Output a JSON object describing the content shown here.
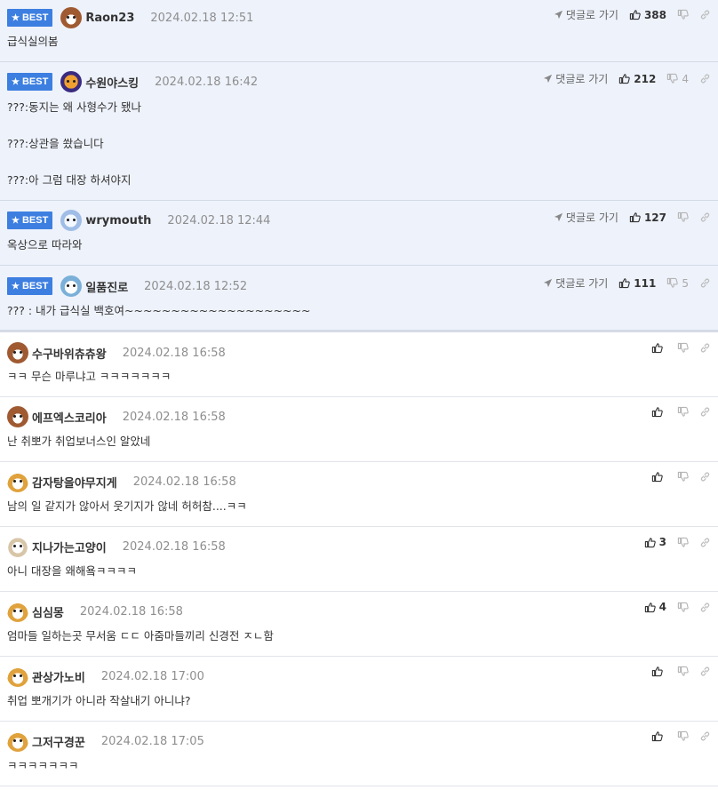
{
  "best_label": "BEST",
  "reply_label": "댓글로 가기",
  "best_comments": [
    {
      "nick": "Raon23",
      "date": "2024.02.18 12:51",
      "avatar_icon": "dog-avatar-icon",
      "up": "388",
      "down": "",
      "lines": [
        "급식실의봄"
      ]
    },
    {
      "nick": "수원야스킹",
      "date": "2024.02.18 16:42",
      "avatar_icon": "cat-avatar-icon",
      "up": "212",
      "down": "4",
      "lines": [
        "???:동지는 왜 사형수가 됐나",
        "???:상관을 쐈습니다",
        "???:아 그럼 대장 하셔야지"
      ]
    },
    {
      "nick": "wrymouth",
      "date": "2024.02.18 12:44",
      "avatar_icon": "ghost-avatar-icon",
      "up": "127",
      "down": "",
      "lines": [
        "옥상으로 따라와"
      ]
    },
    {
      "nick": "일품진로",
      "date": "2024.02.18 12:52",
      "avatar_icon": "seal-avatar-icon",
      "up": "111",
      "down": "5",
      "lines": [
        "??? : 내가 급식실 백호여~~~~~~~~~~~~~~~~~~~~"
      ]
    }
  ],
  "comments": [
    {
      "nick": "수구바위츄츄왕",
      "date": "2024.02.18 16:58",
      "avatar_icon": "dog-avatar-icon",
      "up": "",
      "text": "ㅋㅋ 무슨 마루냐고 ㅋㅋㅋㅋㅋㅋㅋ"
    },
    {
      "nick": "에프엑스코리아",
      "date": "2024.02.18 16:58",
      "avatar_icon": "dog-avatar-icon",
      "up": "",
      "text": "난 취뽀가 취업보너스인 알았네"
    },
    {
      "nick": "감자탕을야무지게",
      "date": "2024.02.18 16:58",
      "avatar_icon": "fox-avatar-icon",
      "up": "",
      "text": "남의 일 같지가 않아서 웃기지가 않네 허허참....ㅋㅋ"
    },
    {
      "nick": "지나가는고양이",
      "date": "2024.02.18 16:58",
      "avatar_icon": "puppy-avatar-icon",
      "up": "3",
      "text": "아니 대장을 왜해욬ㅋㅋㅋㅋ"
    },
    {
      "nick": "심심몽",
      "date": "2024.02.18 16:58",
      "avatar_icon": "fox-avatar-icon",
      "up": "4",
      "text": "엄마들 일하는곳 무서움 ㄷㄷ 아줌마들끼리 신경전 ㅈㄴ함"
    },
    {
      "nick": "관상가노비",
      "date": "2024.02.18 17:00",
      "avatar_icon": "fox-avatar-icon",
      "up": "",
      "text": "취업 뽀개기가 아니라 작살내기 아니냐?"
    },
    {
      "nick": "그저구경꾼",
      "date": "2024.02.18 17:05",
      "avatar_icon": "fox-avatar-icon",
      "up": "",
      "text": "ㅋㅋㅋㅋㅋㅋㅋ"
    }
  ]
}
